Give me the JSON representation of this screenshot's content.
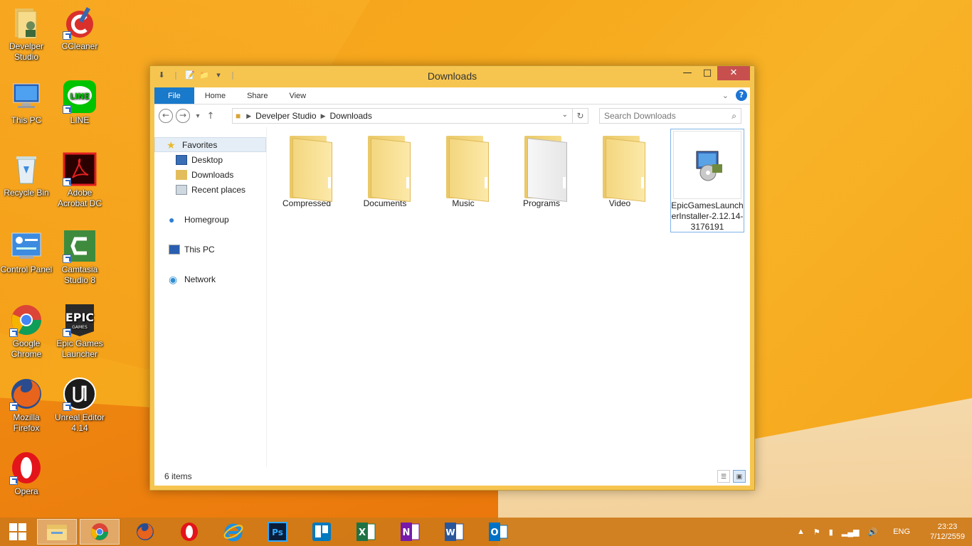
{
  "desktop": {
    "icons": [
      {
        "label": "Develper Studio"
      },
      {
        "label": "CCleaner"
      },
      {
        "label": "This PC"
      },
      {
        "label": "LINE"
      },
      {
        "label": "Recycle Bin"
      },
      {
        "label": "Adobe Acrobat DC"
      },
      {
        "label": "Control Panel"
      },
      {
        "label": "Camtasia Studio 8"
      },
      {
        "label": "Google Chrome"
      },
      {
        "label": "Epic Games Launcher"
      },
      {
        "label": "Mozilla Firefox"
      },
      {
        "label": "Unreal Editor 4.14"
      },
      {
        "label": "Opera"
      }
    ]
  },
  "window": {
    "title": "Downloads",
    "ribbon": {
      "file": "File",
      "home": "Home",
      "share": "Share",
      "view": "View"
    },
    "address": {
      "crumb1": "Develper Studio",
      "crumb2": "Downloads"
    },
    "search": {
      "placeholder": "Search Downloads"
    },
    "nav": {
      "favorites": "Favorites",
      "desktop": "Desktop",
      "downloads": "Downloads",
      "recent": "Recent places",
      "homegroup": "Homegroup",
      "thispc": "This PC",
      "network": "Network"
    },
    "items": [
      {
        "name": "Compressed"
      },
      {
        "name": "Documents"
      },
      {
        "name": "Music"
      },
      {
        "name": "Programs"
      },
      {
        "name": "Video"
      },
      {
        "name": "EpicGamesLauncherInstaller-2.12.14-3176191"
      }
    ],
    "status": "6 items"
  },
  "taskbar": {
    "lang": "ENG",
    "time": "23:23",
    "date": "7/12/2559"
  },
  "colors": {
    "accent": "#1979ca",
    "close": "#c7504f",
    "frame": "#f6c54f"
  }
}
